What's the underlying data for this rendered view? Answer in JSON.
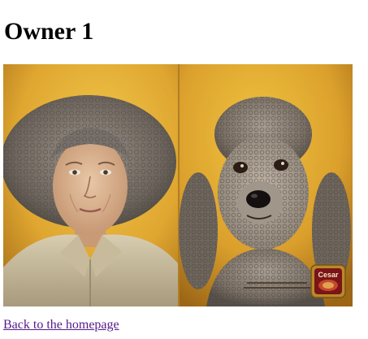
{
  "page": {
    "title": "Owner 1",
    "back_link": "Back to the homepage"
  },
  "ad": {
    "brand": "Cesar",
    "colors": {
      "background": "#ddaa33",
      "link": "#551a8b"
    }
  }
}
